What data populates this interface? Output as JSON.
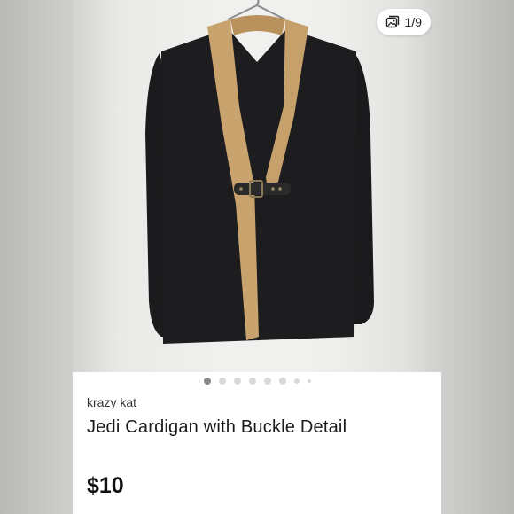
{
  "listing": {
    "image_counter": "1/9",
    "carousel": {
      "total_dots": 8,
      "active_index": 0
    },
    "brand": "krazy kat",
    "title": "Jedi Cardigan with Buckle Detail",
    "price": "$10"
  },
  "icons": {
    "counter": "image-stack-icon",
    "chat": "chat-assistant-icon"
  },
  "colors": {
    "garment": "#1b1b1d",
    "collar": "#c9a36d",
    "fab": "#8f8f8f"
  }
}
